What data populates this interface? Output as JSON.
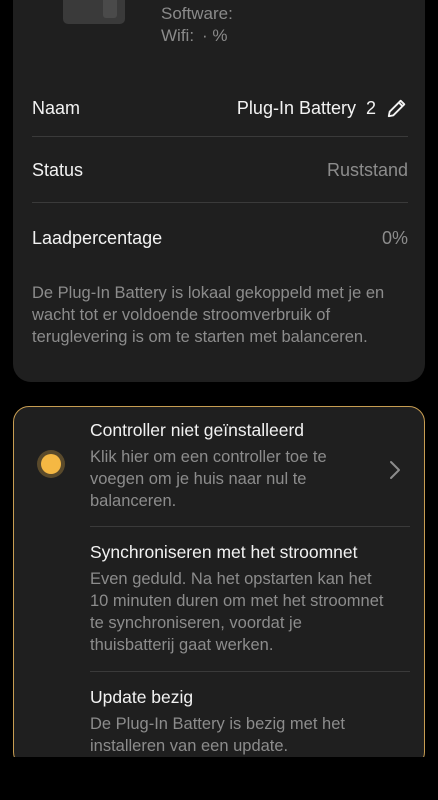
{
  "device_info": {
    "software_label": "Software:",
    "wifi_label": "Wifi:",
    "wifi_value": "· %"
  },
  "settings": {
    "name_label": "Naam",
    "name_value": "Plug-In Battery  2",
    "status_label": "Status",
    "status_value": "Ruststand",
    "charge_label": "Laadpercentage",
    "charge_value": "0%",
    "description": "De Plug-In Battery is lokaal gekoppeld met je  en wacht tot er voldoende stroomverbruik of teruglevering is om te starten met balanceren."
  },
  "setup_steps": [
    {
      "title": "Controller niet geïnstalleerd",
      "description": "Klik hier om een controller toe te voegen om je huis naar nul te balanceren."
    },
    {
      "title": "Synchroniseren met het stroomnet",
      "description": "Even geduld. Na het opstarten kan het 10 minuten duren om met het stroomnet te synchroniseren, voordat je thuisbatterij gaat werken."
    },
    {
      "title": "Update bezig",
      "description": "De Plug-In Battery is bezig met het installeren van een update."
    }
  ],
  "colors": {
    "accent": "#f5b843",
    "card_border": "#c79d52",
    "card_bg": "#1f1f1f"
  },
  "icons": {
    "edit": "pencil-icon",
    "chevron": "chevron-right-icon",
    "status": "status-dot-icon"
  }
}
